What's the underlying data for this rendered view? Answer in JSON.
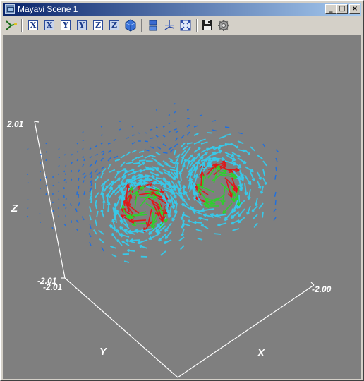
{
  "window": {
    "title": "Mayavi Scene 1",
    "minimize_glyph": "_",
    "maximize_glyph": "□",
    "close_glyph": "×"
  },
  "toolbar": {
    "buttons": [
      {
        "name": "mayavi-icon",
        "glyph": ""
      },
      {
        "name": "view-x-neg-button",
        "glyph": "X"
      },
      {
        "name": "view-x-pos-button",
        "glyph": "X"
      },
      {
        "name": "view-y-neg-button",
        "glyph": "Y"
      },
      {
        "name": "view-y-pos-button",
        "glyph": "Y"
      },
      {
        "name": "view-z-neg-button",
        "glyph": "Z"
      },
      {
        "name": "view-z-pos-button",
        "glyph": "Z"
      },
      {
        "name": "isometric-view-button",
        "glyph": ""
      },
      {
        "name": "parallel-projection-button",
        "glyph": ""
      },
      {
        "name": "toggle-axes-button",
        "glyph": ""
      },
      {
        "name": "fullscreen-button",
        "glyph": ""
      },
      {
        "name": "save-button",
        "glyph": ""
      },
      {
        "name": "configure-button",
        "glyph": ""
      }
    ]
  },
  "scene": {
    "background_color": "#7f7f7f",
    "axis_color": "#ffffff",
    "axis_labels": {
      "x": "X",
      "y": "Y",
      "z": "Z"
    },
    "ticks": {
      "z_top": "2.01",
      "z_bottom": "-2.01",
      "y_end": "-2.01",
      "x_end": "-2.00"
    },
    "glyph_colors": {
      "low": "#1e6fe0",
      "mid": "#38c8e8",
      "high_green": "#2ed02e",
      "high_red": "#e01818"
    }
  }
}
